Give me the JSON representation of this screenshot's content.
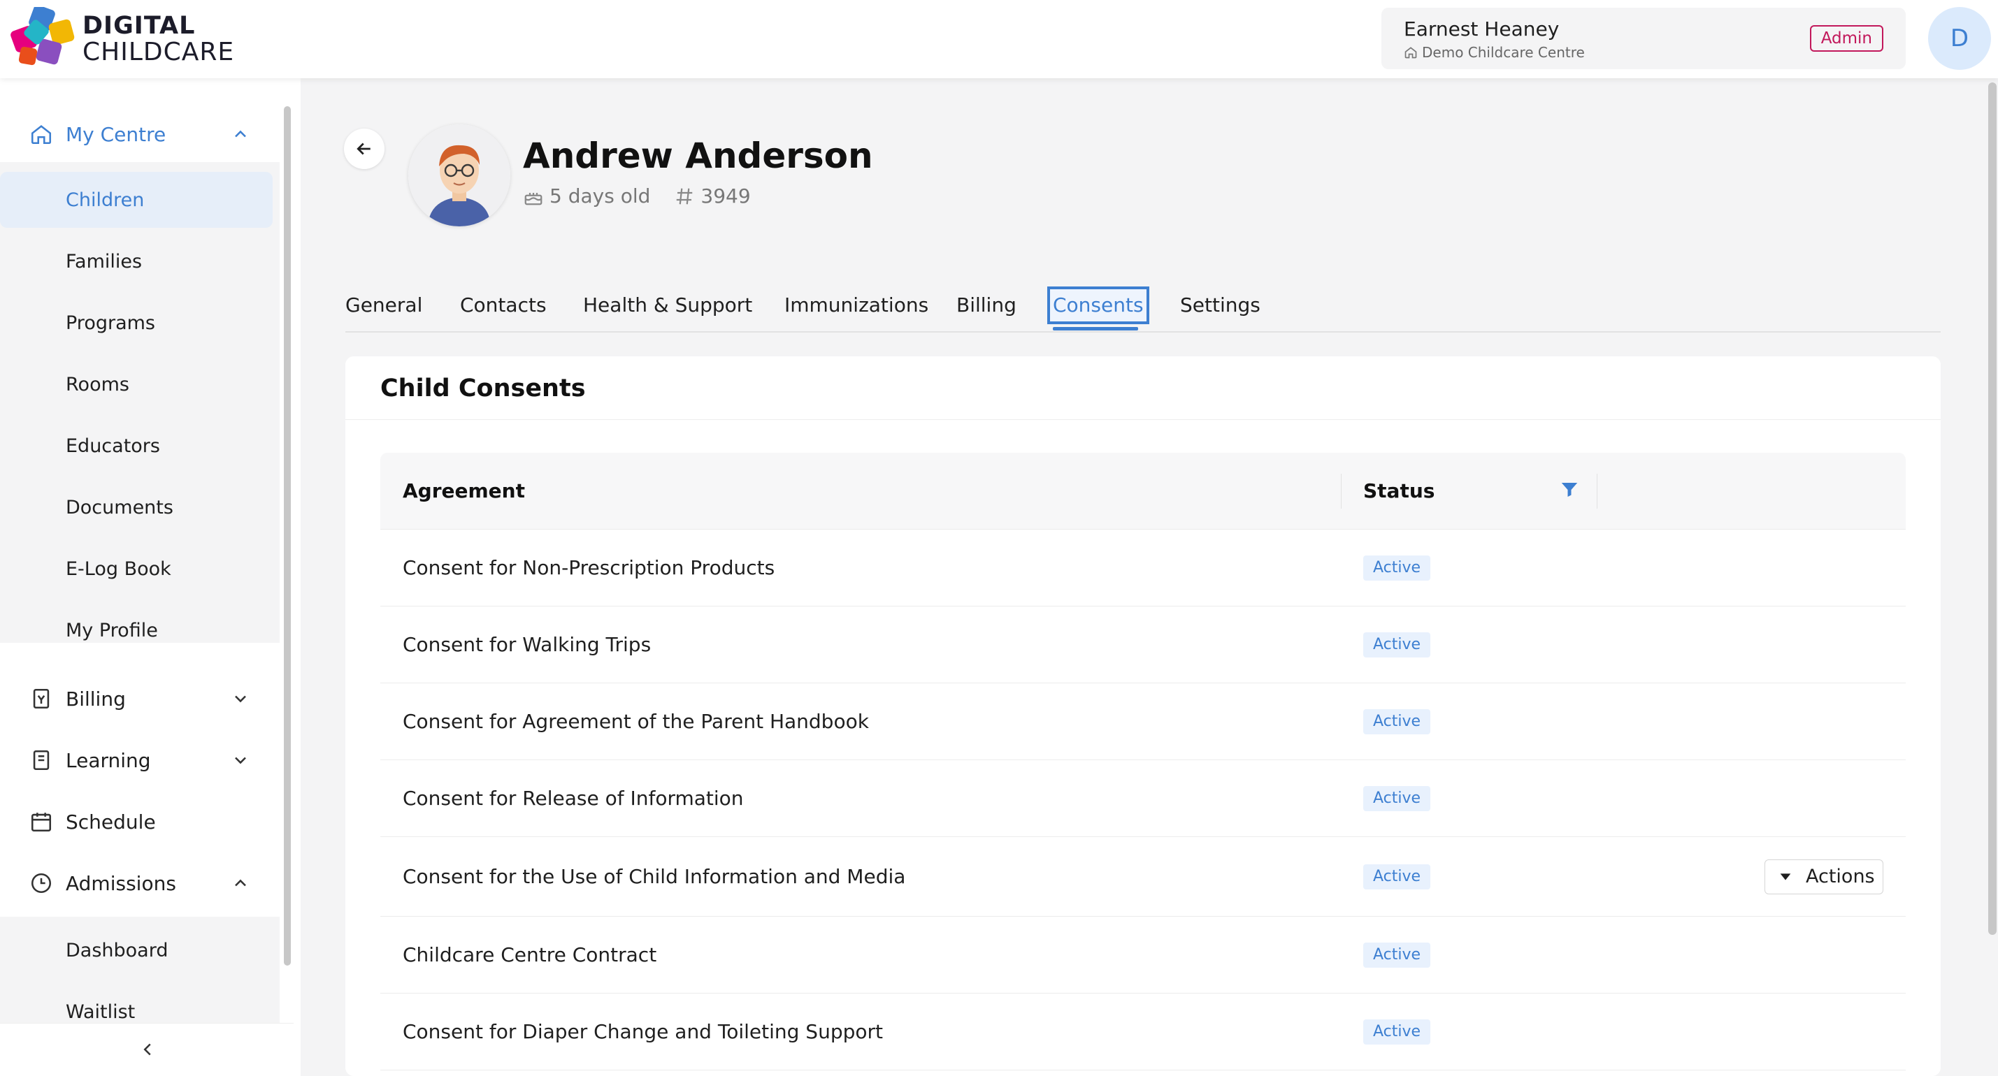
{
  "brand": {
    "line1": "DIGITAL",
    "line2": "CHILDCARE"
  },
  "user": {
    "name": "Earnest Heaney",
    "centre": "Demo Childcare Centre",
    "role": "Admin",
    "avatar_initial": "D"
  },
  "sidebar": {
    "my_centre": "My Centre",
    "my_centre_items": [
      "Children",
      "Families",
      "Programs",
      "Rooms",
      "Educators",
      "Documents",
      "E-Log Book",
      "My Profile"
    ],
    "billing": "Billing",
    "learning": "Learning",
    "schedule": "Schedule",
    "admissions": "Admissions",
    "admissions_items": [
      "Dashboard",
      "Waitlist"
    ]
  },
  "child": {
    "name": "Andrew Anderson",
    "age": "5 days old",
    "id": "3949"
  },
  "tabs": [
    "General",
    "Contacts",
    "Health & Support",
    "Immunizations",
    "Billing",
    "Consents",
    "Settings"
  ],
  "active_tab": "Consents",
  "consents": {
    "title": "Child Consents",
    "columns": {
      "agreement": "Agreement",
      "status": "Status"
    },
    "actions_label": "Actions",
    "rows": [
      {
        "agreement": "Consent for Non-Prescription Products",
        "status": "Active"
      },
      {
        "agreement": "Consent for Walking Trips",
        "status": "Active"
      },
      {
        "agreement": "Consent for Agreement of the Parent Handbook",
        "status": "Active"
      },
      {
        "agreement": "Consent for Release of Information",
        "status": "Active"
      },
      {
        "agreement": "Consent for the Use of Child Information and Media",
        "status": "Active"
      },
      {
        "agreement": "Childcare Centre Contract",
        "status": "Active"
      },
      {
        "agreement": "Consent for Diaper Change and Toileting Support",
        "status": "Active"
      }
    ]
  },
  "colors": {
    "accent": "#3d7fd1",
    "admin_badge": "#c2185b"
  }
}
